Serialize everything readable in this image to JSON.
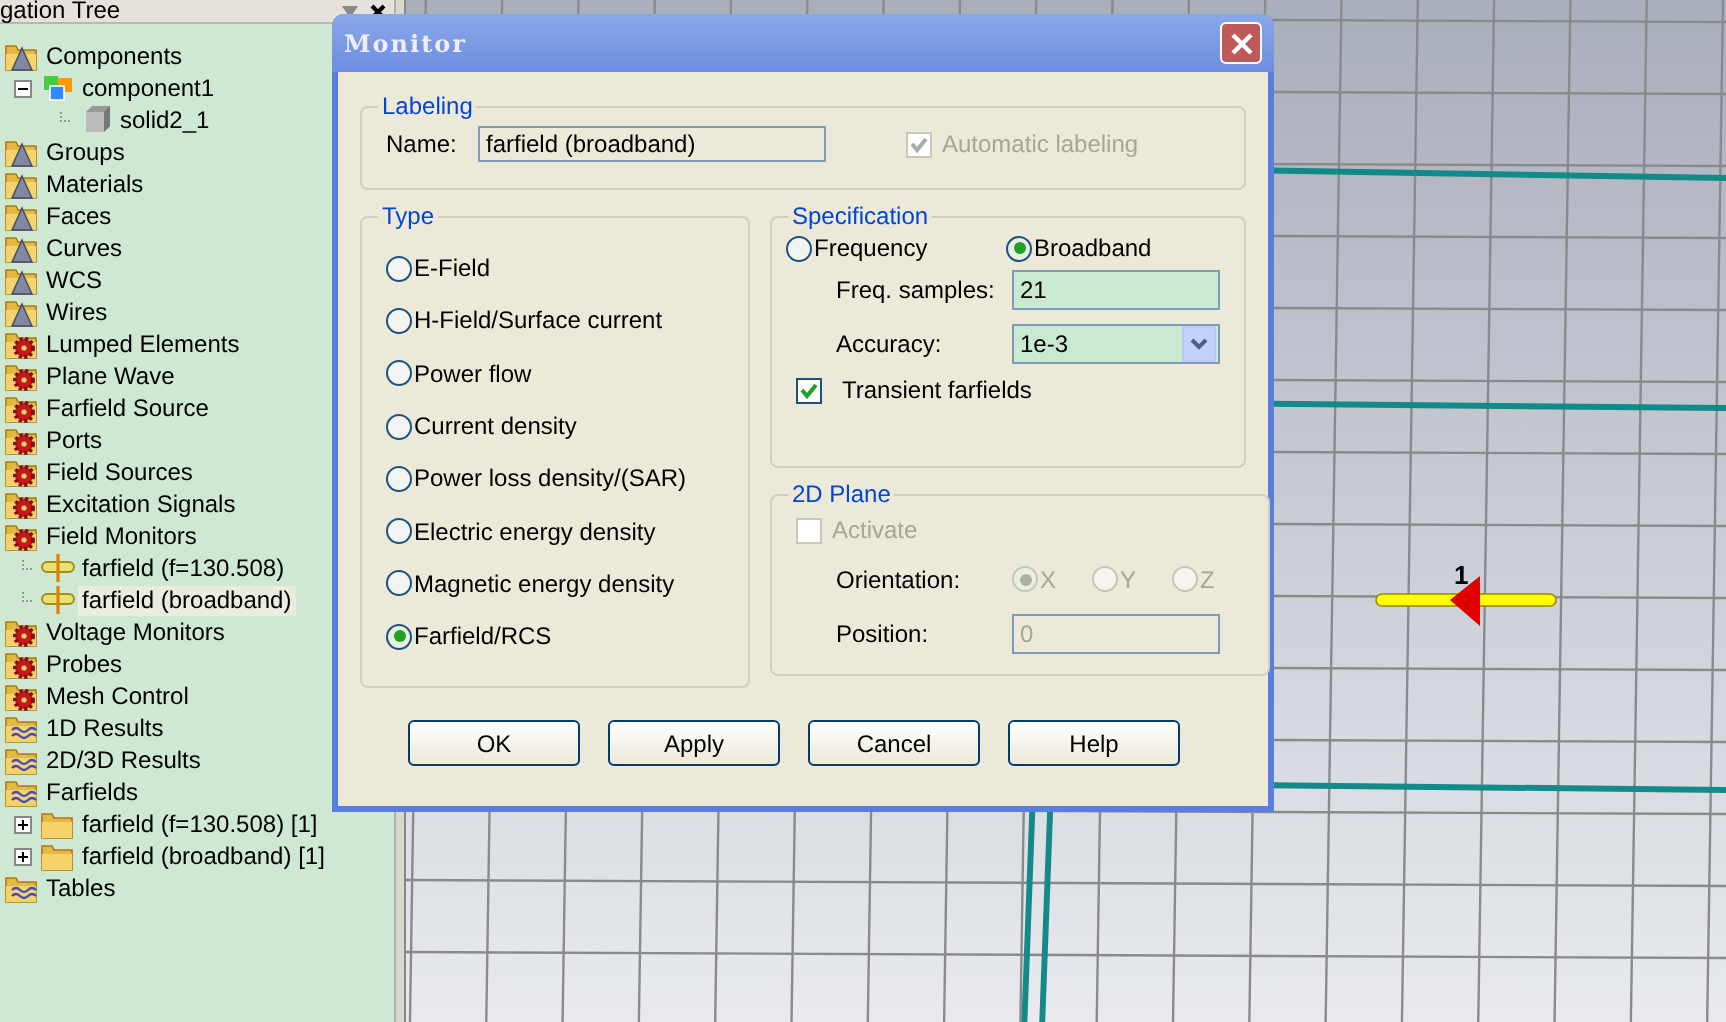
{
  "panel": {
    "title": "gation Tree"
  },
  "tree": [
    {
      "label": "Components",
      "kind": "cone",
      "selected": false,
      "children": [
        {
          "label": "component1",
          "kind": "component",
          "expanded": true,
          "selected": false,
          "children": [
            {
              "label": "solid2_1",
              "kind": "solid",
              "selected": false
            }
          ]
        }
      ]
    },
    {
      "label": "Groups",
      "kind": "cone",
      "selected": false
    },
    {
      "label": "Materials",
      "kind": "cone",
      "selected": false
    },
    {
      "label": "Faces",
      "kind": "cone",
      "selected": false
    },
    {
      "label": "Curves",
      "kind": "cone",
      "selected": false
    },
    {
      "label": "WCS",
      "kind": "cone",
      "selected": false
    },
    {
      "label": "Wires",
      "kind": "cone",
      "selected": false
    },
    {
      "label": "Lumped Elements",
      "kind": "gear",
      "selected": false
    },
    {
      "label": "Plane Wave",
      "kind": "gear",
      "selected": false
    },
    {
      "label": "Farfield Source",
      "kind": "gear",
      "selected": false
    },
    {
      "label": "Ports",
      "kind": "gear",
      "selected": false
    },
    {
      "label": "Field Sources",
      "kind": "gear",
      "selected": false
    },
    {
      "label": "Excitation Signals",
      "kind": "gear",
      "selected": false
    },
    {
      "label": "Field Monitors",
      "kind": "gear",
      "selected": false,
      "children": [
        {
          "label": "farfield (f=130.508)",
          "kind": "monitor",
          "selected": false
        },
        {
          "label": "farfield (broadband)",
          "kind": "monitor",
          "selected": true
        }
      ]
    },
    {
      "label": "Voltage Monitors",
      "kind": "gear",
      "selected": false
    },
    {
      "label": "Probes",
      "kind": "gear",
      "selected": false
    },
    {
      "label": "Mesh Control",
      "kind": "gear",
      "selected": false
    },
    {
      "label": "1D Results",
      "kind": "wave",
      "selected": false
    },
    {
      "label": "2D/3D Results",
      "kind": "wave",
      "selected": false
    },
    {
      "label": "Farfields",
      "kind": "wave",
      "selected": false,
      "children": [
        {
          "label": "farfield (f=130.508) [1]",
          "kind": "folder",
          "expanded": false,
          "selected": false
        },
        {
          "label": "farfield (broadband) [1]",
          "kind": "folder",
          "expanded": false,
          "selected": false
        }
      ]
    },
    {
      "label": "Tables",
      "kind": "wave",
      "selected": false
    }
  ],
  "viewport": {
    "port_label": "1"
  },
  "dialog": {
    "title": "Monitor",
    "labeling": {
      "title": "Labeling",
      "name_label": "Name:",
      "name_value": "farfield (broadband)",
      "auto": {
        "label": "Automatic labeling",
        "checked": true,
        "disabled": true
      }
    },
    "type": {
      "title": "Type",
      "options": [
        {
          "label": "E-Field",
          "selected": false
        },
        {
          "label": "H-Field/Surface current",
          "selected": false
        },
        {
          "label": "Power flow",
          "selected": false
        },
        {
          "label": "Current density",
          "selected": false
        },
        {
          "label": "Power loss density/(SAR)",
          "selected": false
        },
        {
          "label": "Electric energy density",
          "selected": false
        },
        {
          "label": "Magnetic energy density",
          "selected": false
        },
        {
          "label": "Farfield/RCS",
          "selected": true
        }
      ]
    },
    "specification": {
      "title": "Specification",
      "modes": [
        {
          "label": "Frequency",
          "selected": false
        },
        {
          "label": "Broadband",
          "selected": true
        }
      ],
      "freq_samples": {
        "label": "Freq. samples:",
        "value": "21"
      },
      "accuracy": {
        "label": "Accuracy:",
        "value": "1e-3"
      },
      "transient": {
        "label": "Transient farfields",
        "checked": true
      }
    },
    "plane": {
      "title": "2D Plane",
      "activate": {
        "label": "Activate",
        "checked": false,
        "disabled": true
      },
      "orientation": {
        "label": "Orientation:",
        "disabled": true,
        "options": [
          {
            "label": "X",
            "selected": true
          },
          {
            "label": "Y",
            "selected": false
          },
          {
            "label": "Z",
            "selected": false
          }
        ]
      },
      "position": {
        "label": "Position:",
        "value": "0",
        "disabled": true
      }
    },
    "buttons": [
      "OK",
      "Apply",
      "Cancel",
      "Help"
    ]
  }
}
